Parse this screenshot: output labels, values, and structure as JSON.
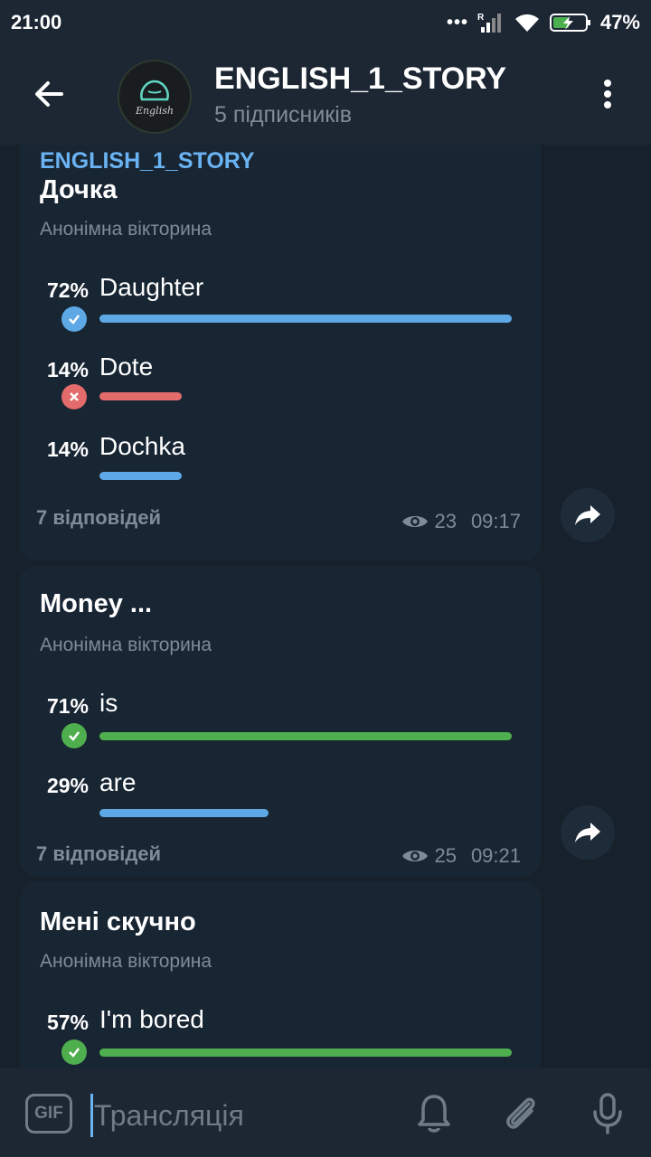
{
  "status": {
    "time": "21:00",
    "battery": "47%",
    "signal_label": "R"
  },
  "header": {
    "title": "ENGLISH_1_STORY",
    "subtitle": "5 підписників",
    "avatar_text": "English"
  },
  "posts": [
    {
      "channel": "ENGLISH_1_STORY",
      "question": "Дочка",
      "type": "Анонімна вікторина",
      "options": [
        {
          "pct": "72%",
          "text": "Daughter",
          "fraction": 1.0,
          "state": "correct",
          "bar_color": "#5ea8e6"
        },
        {
          "pct": "14%",
          "text": "Dote",
          "fraction": 0.2,
          "state": "wrong",
          "bar_color": "#e36b6b"
        },
        {
          "pct": "14%",
          "text": "Dochka",
          "fraction": 0.2,
          "state": "none",
          "bar_color": "#5ea8e6"
        }
      ],
      "answers": "7 відповідей",
      "views": "23",
      "time": "09:17"
    },
    {
      "question": "Money ...",
      "type": "Анонімна вікторина",
      "options": [
        {
          "pct": "71%",
          "text": "is",
          "fraction": 1.0,
          "state": "correct-green",
          "bar_color": "#4fae4e"
        },
        {
          "pct": "29%",
          "text": "are",
          "fraction": 0.41,
          "state": "none",
          "bar_color": "#5ea8e6"
        }
      ],
      "answers": "7 відповідей",
      "views": "25",
      "time": "09:21"
    },
    {
      "question": "Мені скучно",
      "type": "Анонімна вікторина",
      "options": [
        {
          "pct": "57%",
          "text": "I'm bored",
          "fraction": 1.0,
          "state": "correct-green",
          "bar_color": "#4fae4e"
        }
      ]
    }
  ],
  "input": {
    "placeholder": "Трансляція",
    "gif_label": "GIF"
  },
  "colors": {
    "header_bg": "#1c2733",
    "bubble_bg": "#182533",
    "accent": "#6ab3f3",
    "muted": "#7f8b96"
  }
}
